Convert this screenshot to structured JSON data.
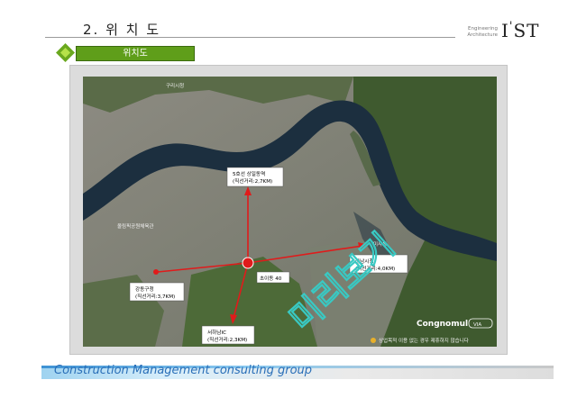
{
  "header": {
    "title": "2. 위 치 도",
    "logo_sub_line1": "Engineering",
    "logo_sub_line2": "Architecture",
    "logo_main": "I",
    "logo_sup": "'",
    "logo_rest": "ST"
  },
  "section": {
    "label": "위치도"
  },
  "map": {
    "labels": {
      "top_place": "구리시청",
      "station": "5호선 상일동역",
      "station_dist": "(직선거리:2,7KM)",
      "gangdong": "강동구청",
      "gangdong_dist": "(직선거리:3,7KM)",
      "center": "초이동 40",
      "hanam": "하남시청",
      "hanam_dist": "(직선거리:4,0KM)",
      "seohanam": "서하남IC",
      "seohanam_dist": "(직선거리:2,3KM)",
      "olympic": "올림픽공원체육관",
      "dongsan": "미사동",
      "brand_1": "Congnomul",
      "brand_2": "VIA",
      "notice": "상업목적 이용 없는 경우 제휴하지 않습니다"
    },
    "watermark": "미리보기"
  },
  "footer": {
    "text": "Construction Management  consulting group"
  },
  "colors": {
    "accent_green": "#5f9e1a",
    "route_red": "#e01b1b",
    "footer_blue": "#2a6fb8"
  }
}
